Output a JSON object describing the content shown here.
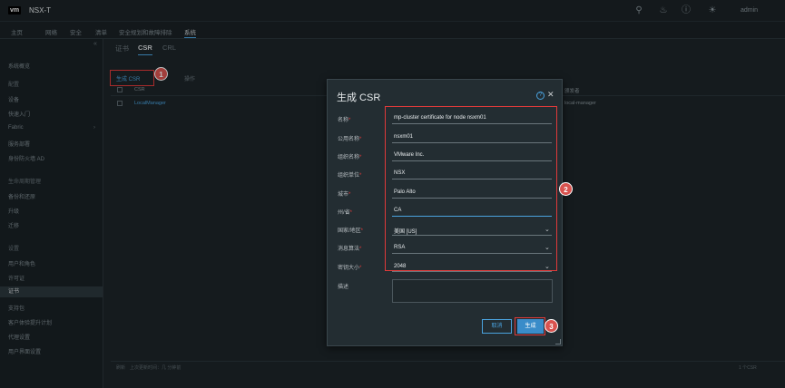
{
  "app": {
    "logo": "vm",
    "product": "NSX-T",
    "user": "admin"
  },
  "nav_tabs": [
    "主页",
    "网络",
    "安全",
    "清单",
    "安全规划和故障排除",
    "系统"
  ],
  "sidebar": {
    "items": [
      {
        "label": "系统概览"
      },
      {
        "label": "配置",
        "head": true
      },
      {
        "label": "设备"
      },
      {
        "label": "快速入门"
      },
      {
        "label": "Fabric"
      },
      {
        "label": "服务部署"
      },
      {
        "label": "身份防火墙 AD"
      },
      {
        "label": "生命周期管理",
        "head": true
      },
      {
        "label": "备份和还原"
      },
      {
        "label": "升级"
      },
      {
        "label": "迁移"
      },
      {
        "label": "设置",
        "head": true
      },
      {
        "label": "用户和角色"
      },
      {
        "label": "许可证"
      },
      {
        "label": "证书",
        "selected": true
      },
      {
        "label": "支持包"
      },
      {
        "label": "客户体验提升计划"
      },
      {
        "label": "代理设置"
      },
      {
        "label": "用户界面设置"
      }
    ]
  },
  "content": {
    "tabs": [
      "证书",
      "CSR",
      "CRL"
    ],
    "generate_label": "生成 CSR",
    "ops_label": "操作",
    "columns": {
      "csr": "CSR",
      "issuer": "颁发者"
    },
    "rows": [
      {
        "name": "LocalManager",
        "issuer": "local-manager"
      }
    ],
    "footer_left": "刷新　上次更新时间：几 分钟前",
    "footer_right": "1 个CSR",
    "step1": "1"
  },
  "dialog": {
    "title": "生成 CSR",
    "fields": [
      {
        "label": "名称",
        "value": "mp-cluster certificate for node nsxm01",
        "required": true
      },
      {
        "label": "公用名称",
        "value": "nsxm01",
        "required": true
      },
      {
        "label": "组织名称",
        "value": "VMware Inc.",
        "required": true
      },
      {
        "label": "组织单位",
        "value": "NSX",
        "required": true
      },
      {
        "label": "城市",
        "value": "Palo Alto",
        "required": true
      },
      {
        "label": "州/省",
        "value": "CA",
        "required": true,
        "focused": true
      },
      {
        "label": "国家/地区",
        "value": "美国 [US]",
        "required": true,
        "select": true
      },
      {
        "label": "消息算法",
        "value": "RSA",
        "required": true,
        "select": true
      },
      {
        "label": "密钥大小",
        "value": "2048",
        "required": true,
        "select": true
      }
    ],
    "description_label": "描述",
    "cancel_label": "取消",
    "generate_label": "生成",
    "step2": "2",
    "step3": "3"
  },
  "colors": {
    "accent": "#4aa3df",
    "highlight": "#e03a3a",
    "background": "#1a2125"
  }
}
